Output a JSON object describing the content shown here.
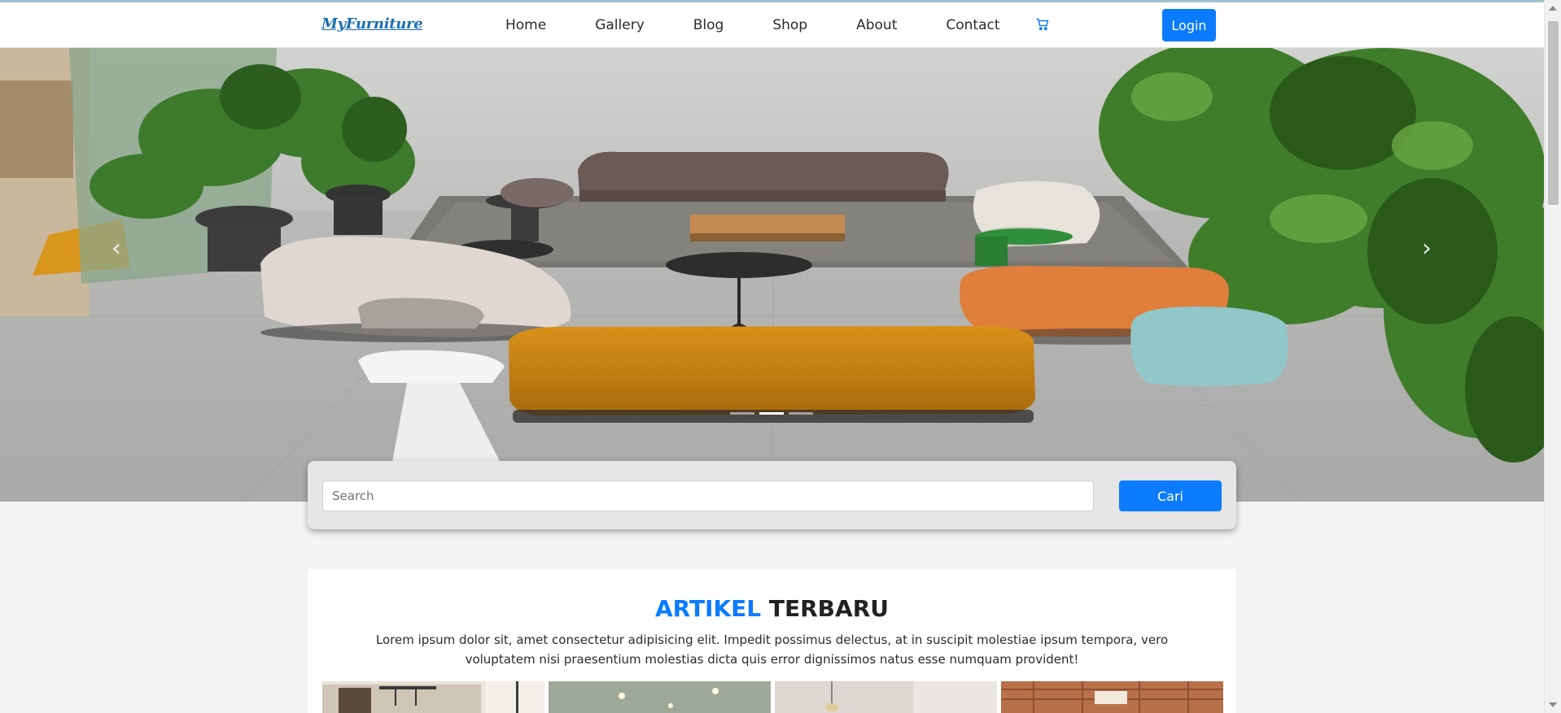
{
  "brand": {
    "name": "MyFurniture"
  },
  "nav": {
    "items": [
      {
        "label": "Home"
      },
      {
        "label": "Gallery"
      },
      {
        "label": "Blog"
      },
      {
        "label": "Shop"
      },
      {
        "label": "About"
      },
      {
        "label": "Contact"
      }
    ],
    "cart_icon": "shopping-cart-icon",
    "login_label": "Login"
  },
  "hero": {
    "prev_icon": "chevron-left-icon",
    "next_icon": "chevron-right-icon",
    "prev_glyph": "‹",
    "next_glyph": "›",
    "indicator_count": 3,
    "active_indicator": 2
  },
  "search": {
    "placeholder": "Search",
    "value": "",
    "button_label": "Cari"
  },
  "articles": {
    "title_accent": "ARTIKEL",
    "title_rest": "TERBARU",
    "description": "Lorem ipsum dolor sit, amet consectetur adipisicing elit. Impedit possimus delectus, at in suscipit molestiae ipsum tempora, vero voluptatem nisi praesentium molestias dicta quis error dignissimos natus esse numquam provident!"
  },
  "colors": {
    "accent": "#0b7bff",
    "brand": "#1a6fb0",
    "page_bg": "#f4f4f4"
  }
}
